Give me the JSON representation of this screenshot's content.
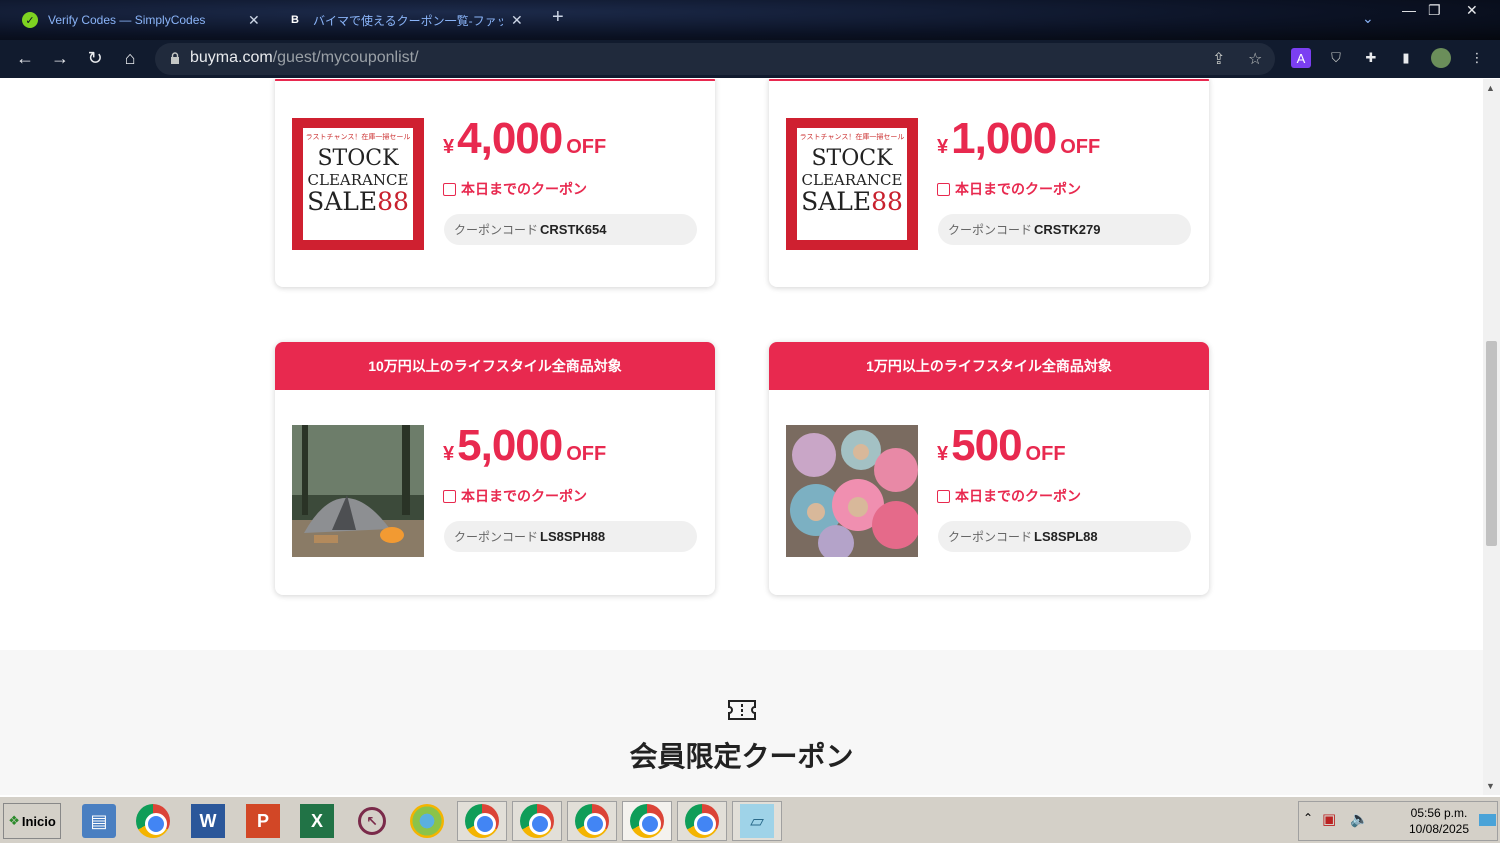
{
  "browser": {
    "tabs": [
      {
        "title": "Verify Codes — SimplyCodes",
        "favicon": "simplycodes-icon"
      },
      {
        "title": "バイマで使えるクーポン一覧-ファッション通",
        "favicon": "B"
      }
    ],
    "url_host": "buyma.com",
    "url_path": "/guest/mycouponlist/"
  },
  "coupons": [
    {
      "header": "",
      "amount": "4,000",
      "yen": "¥",
      "off": "OFF",
      "expiry": "本日までのクーポン",
      "code_label": "クーポンコード",
      "code": "CRSTK654",
      "image": "stock-clearance"
    },
    {
      "header": "",
      "amount": "1,000",
      "yen": "¥",
      "off": "OFF",
      "expiry": "本日までのクーポン",
      "code_label": "クーポンコード",
      "code": "CRSTK279",
      "image": "stock-clearance"
    },
    {
      "header": "10万円以上のライフスタイル全商品対象",
      "amount": "5,000",
      "yen": "¥",
      "off": "OFF",
      "expiry": "本日までのクーポン",
      "code_label": "クーポンコード",
      "code": "LS8SPH88",
      "image": "tent-photo"
    },
    {
      "header": "1万円以上のライフスタイル全商品対象",
      "amount": "500",
      "yen": "¥",
      "off": "OFF",
      "expiry": "本日までのクーポン",
      "code_label": "クーポンコード",
      "code": "LS8SPL88",
      "image": "plush-toys-photo"
    }
  ],
  "stock_banner": {
    "small": "ラストチャンス！在庫一掃セール",
    "line1": "STOCK",
    "line2": "CLEARANCE",
    "line3": "SALE",
    "pct": "88"
  },
  "member_section": {
    "title": "会員限定クーポン"
  },
  "taskbar": {
    "start": "Inicio",
    "time": "05:56 p.m.",
    "date": "10/08/2025"
  },
  "colors": {
    "accent": "#e8294f",
    "chrome_bg": "#111b2e"
  }
}
